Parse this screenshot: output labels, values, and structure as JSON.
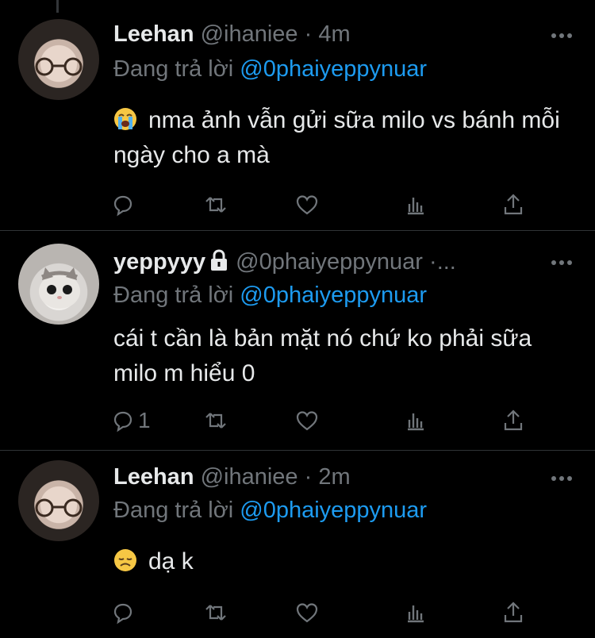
{
  "tweets": [
    {
      "name": "Leehan",
      "handle": "@ihaniee",
      "dot": "·",
      "time": "4m",
      "reply_prefix": "Đang trả lời",
      "reply_handle": "@0phaiyeppynuar",
      "text": "nma ảnh vẫn gửi sữa milo vs bánh mỗi ngày cho a mà",
      "emoji": "loudly-crying-face",
      "reply_count": ""
    },
    {
      "name": "yeppyyy",
      "handle": "@0phaiyeppynuar",
      "dot": "·...",
      "time": "",
      "reply_prefix": "Đang trả lời",
      "reply_handle": "@0phaiyeppynuar",
      "text": "cái t cần là bản mặt nó chứ ko phải sữa milo m hiểu 0",
      "reply_count": "1"
    },
    {
      "name": "Leehan",
      "handle": "@ihaniee",
      "dot": "·",
      "time": "2m",
      "reply_prefix": "Đang trả lời",
      "reply_handle": "@0phaiyeppynuar",
      "text": "dạ k",
      "emoji": "disappointed-face",
      "reply_count": ""
    }
  ],
  "colors": {
    "background": "#000000",
    "text": "#e7e9ea",
    "muted": "#71767b",
    "link": "#1d9bf0",
    "separator": "#2f3336"
  }
}
